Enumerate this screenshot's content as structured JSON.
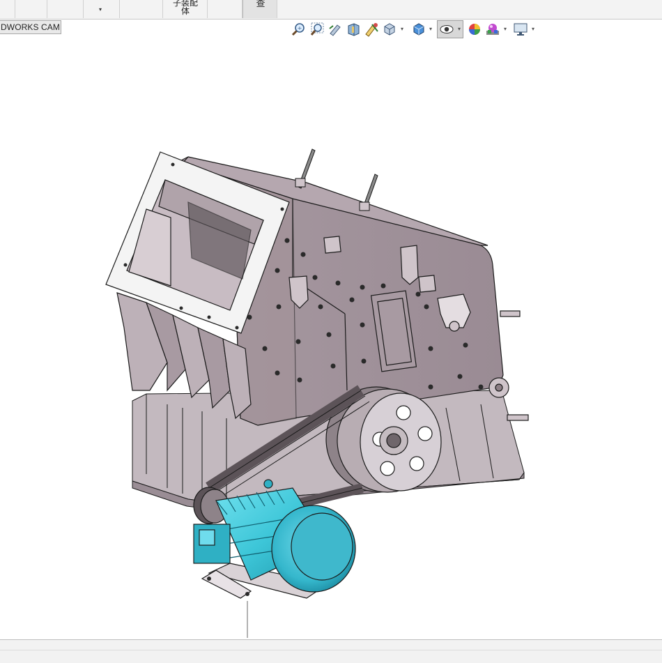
{
  "ribbon": {
    "assembly_label_line1": "子装配",
    "assembly_label_line2": "体",
    "inspect_label": "查",
    "dropdown_caret": "▾"
  },
  "tab": {
    "label": "DWORKS CAM"
  },
  "heads_up_toolbar": {
    "icons": [
      "zoom-to-fit-icon",
      "zoom-to-area-icon",
      "previous-view-icon",
      "section-view-icon",
      "dynamic-annotation-icon",
      "view-orientation-icon",
      "display-style-icon",
      "hide-show-items-icon",
      "edit-appearance-icon",
      "apply-scene-icon",
      "view-settings-icon"
    ],
    "active_icon": "hide-show-items-icon"
  },
  "viewport": {
    "model": "crusher-assembly",
    "colors": {
      "frame": "#a8979f",
      "frame_dark": "#8d7f86",
      "motor": "#3dc6d8",
      "motor_dark": "#1c8fa3",
      "pulley": "#d7d0d6",
      "outline": "#1a1a1a"
    }
  }
}
